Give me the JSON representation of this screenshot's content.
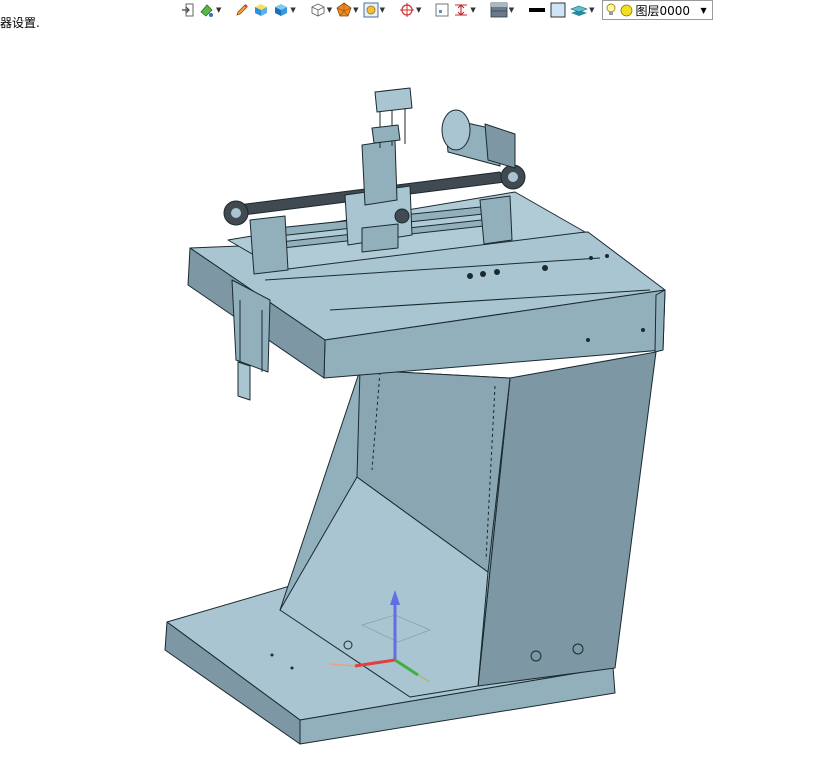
{
  "status_text": "器设置.",
  "layer": {
    "name": "图层0000"
  },
  "colors": {
    "part_light": "#a7c4d0",
    "part_mid": "#8fabb8",
    "part_dark": "#7892a0",
    "edge": "#1a2a30",
    "axis_x": "#e04040",
    "axis_y": "#40b040",
    "axis_z": "#6070e0"
  },
  "toolbar": [
    {
      "id": "exit",
      "icon": "exit-icon",
      "dropdown": false
    },
    {
      "id": "paint",
      "icon": "paint-icon",
      "dropdown": true
    },
    {
      "id": "pencil",
      "icon": "pencil-icon",
      "dropdown": false
    },
    {
      "id": "shade",
      "icon": "shade-icon",
      "dropdown": false
    },
    {
      "id": "solid",
      "icon": "solid-cube-icon",
      "dropdown": true
    },
    {
      "id": "wire",
      "icon": "wire-cube-icon",
      "dropdown": true
    },
    {
      "id": "render",
      "icon": "render-icon",
      "dropdown": true
    },
    {
      "id": "view",
      "icon": "view-icon",
      "dropdown": true
    },
    {
      "id": "target",
      "icon": "target-icon",
      "dropdown": true
    },
    {
      "id": "frame",
      "icon": "frame-icon",
      "dropdown": false
    },
    {
      "id": "dim",
      "icon": "dimension-icon",
      "dropdown": true
    },
    {
      "id": "display",
      "icon": "display-icon",
      "dropdown": true
    },
    {
      "id": "line",
      "icon": "line-icon",
      "dropdown": false
    },
    {
      "id": "color",
      "icon": "color-swatch-icon",
      "dropdown": false
    },
    {
      "id": "layers",
      "icon": "layers-icon",
      "dropdown": true
    }
  ]
}
